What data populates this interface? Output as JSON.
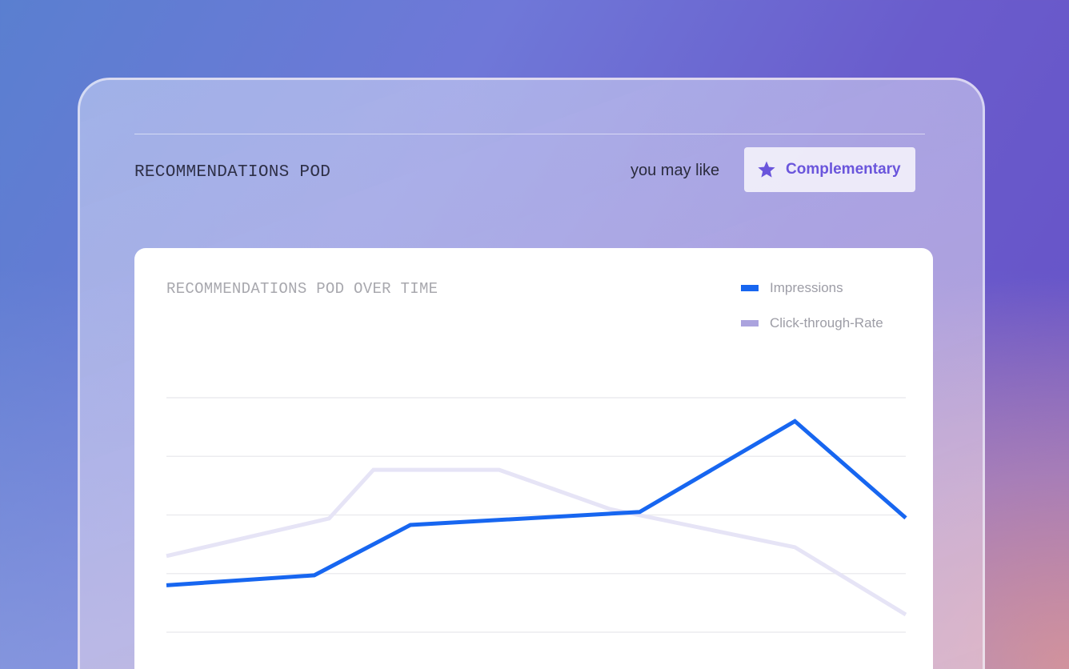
{
  "header": {
    "title": "RECOMMENDATIONS POD",
    "may_like_label": "you may like",
    "complementary_button": {
      "label": "Complementary",
      "icon": "star-icon"
    }
  },
  "chart_card": {
    "title": "RECOMMENDATIONS POD OVER TIME"
  },
  "colors": {
    "impressions": "#1766f0",
    "ctr": "#e6e4f6",
    "ctr_legend": "#aba3de",
    "accent": "#6a55dc"
  },
  "chart_data": {
    "type": "line",
    "title": "RECOMMENDATIONS POD OVER TIME",
    "xlabel": "",
    "ylabel": "",
    "grid": true,
    "legend": "top-right",
    "ylim": [
      0,
      4
    ],
    "series": [
      {
        "name": "Impressions",
        "points": [
          [
            0,
            0.8
          ],
          [
            2,
            0.97
          ],
          [
            3.3,
            1.83
          ],
          [
            6.4,
            2.05
          ],
          [
            8.5,
            3.6
          ],
          [
            10,
            1.95
          ]
        ]
      },
      {
        "name": "Click-through-Rate",
        "points": [
          [
            0,
            1.3
          ],
          [
            2.2,
            1.94
          ],
          [
            2.8,
            2.77
          ],
          [
            4.5,
            2.77
          ],
          [
            6,
            2.1
          ],
          [
            8.5,
            1.45
          ],
          [
            10,
            0.3
          ]
        ]
      }
    ]
  }
}
